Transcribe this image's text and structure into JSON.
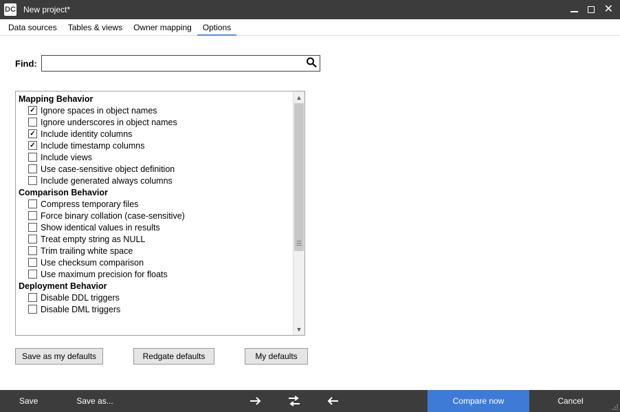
{
  "titlebar": {
    "title": "New project*"
  },
  "tabs": [
    {
      "label": "Data sources",
      "active": false
    },
    {
      "label": "Tables & views",
      "active": false
    },
    {
      "label": "Owner mapping",
      "active": false
    },
    {
      "label": "Options",
      "active": true
    }
  ],
  "find": {
    "label": "Find:",
    "placeholder": "",
    "value": ""
  },
  "sections": [
    {
      "title": "Mapping Behavior",
      "options": [
        {
          "label": "Ignore spaces in object names",
          "checked": true
        },
        {
          "label": "Ignore underscores in object names",
          "checked": false
        },
        {
          "label": "Include identity columns",
          "checked": true
        },
        {
          "label": "Include timestamp columns",
          "checked": true
        },
        {
          "label": "Include views",
          "checked": false
        },
        {
          "label": "Use case-sensitive object definition",
          "checked": false
        },
        {
          "label": "Include generated always columns",
          "checked": false
        }
      ]
    },
    {
      "title": "Comparison Behavior",
      "options": [
        {
          "label": "Compress temporary files",
          "checked": false
        },
        {
          "label": "Force binary collation (case-sensitive)",
          "checked": false
        },
        {
          "label": "Show identical values in results",
          "checked": false
        },
        {
          "label": "Treat empty string as NULL",
          "checked": false
        },
        {
          "label": "Trim trailing white space",
          "checked": false
        },
        {
          "label": "Use checksum comparison",
          "checked": false
        },
        {
          "label": "Use maximum precision for floats",
          "checked": false
        }
      ]
    },
    {
      "title": "Deployment Behavior",
      "options": [
        {
          "label": "Disable DDL triggers",
          "checked": false
        },
        {
          "label": "Disable DML triggers",
          "checked": false
        }
      ]
    }
  ],
  "defaults_buttons": {
    "save_defaults": "Save as my defaults",
    "redgate_defaults": "Redgate defaults",
    "my_defaults": "My defaults"
  },
  "footer": {
    "save": "Save",
    "save_as": "Save as...",
    "compare_now": "Compare now",
    "cancel": "Cancel"
  }
}
